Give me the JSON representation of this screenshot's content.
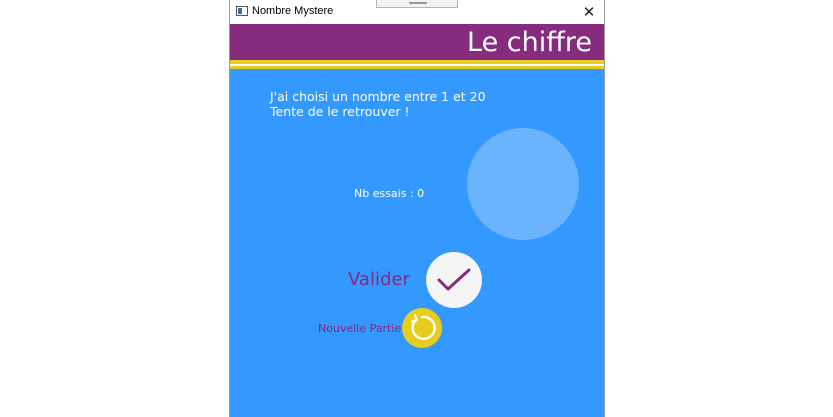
{
  "window": {
    "title": "Nombre Mystere",
    "close_glyph": "✕",
    "icon": "app-window-icon"
  },
  "header": {
    "title": "Le chiffre",
    "bar_color": "#862b7d",
    "stripe_color": "#e8cc1e"
  },
  "intro": {
    "line1": "J'ai choisi un nombre entre 1 et 20",
    "line2": "Tente de le retrouver !"
  },
  "status": {
    "attempts": "Nb essais : 0"
  },
  "actions": {
    "validate_label": "Valider",
    "validate_icon": "check-icon",
    "new_game_label": "Nouvelle Partie",
    "new_game_icon": "refresh-icon"
  },
  "colors": {
    "background": "#3399ff",
    "answer_circle": "#6bb4fd",
    "accent": "#862b7d",
    "yellow": "#e8cc1e"
  }
}
